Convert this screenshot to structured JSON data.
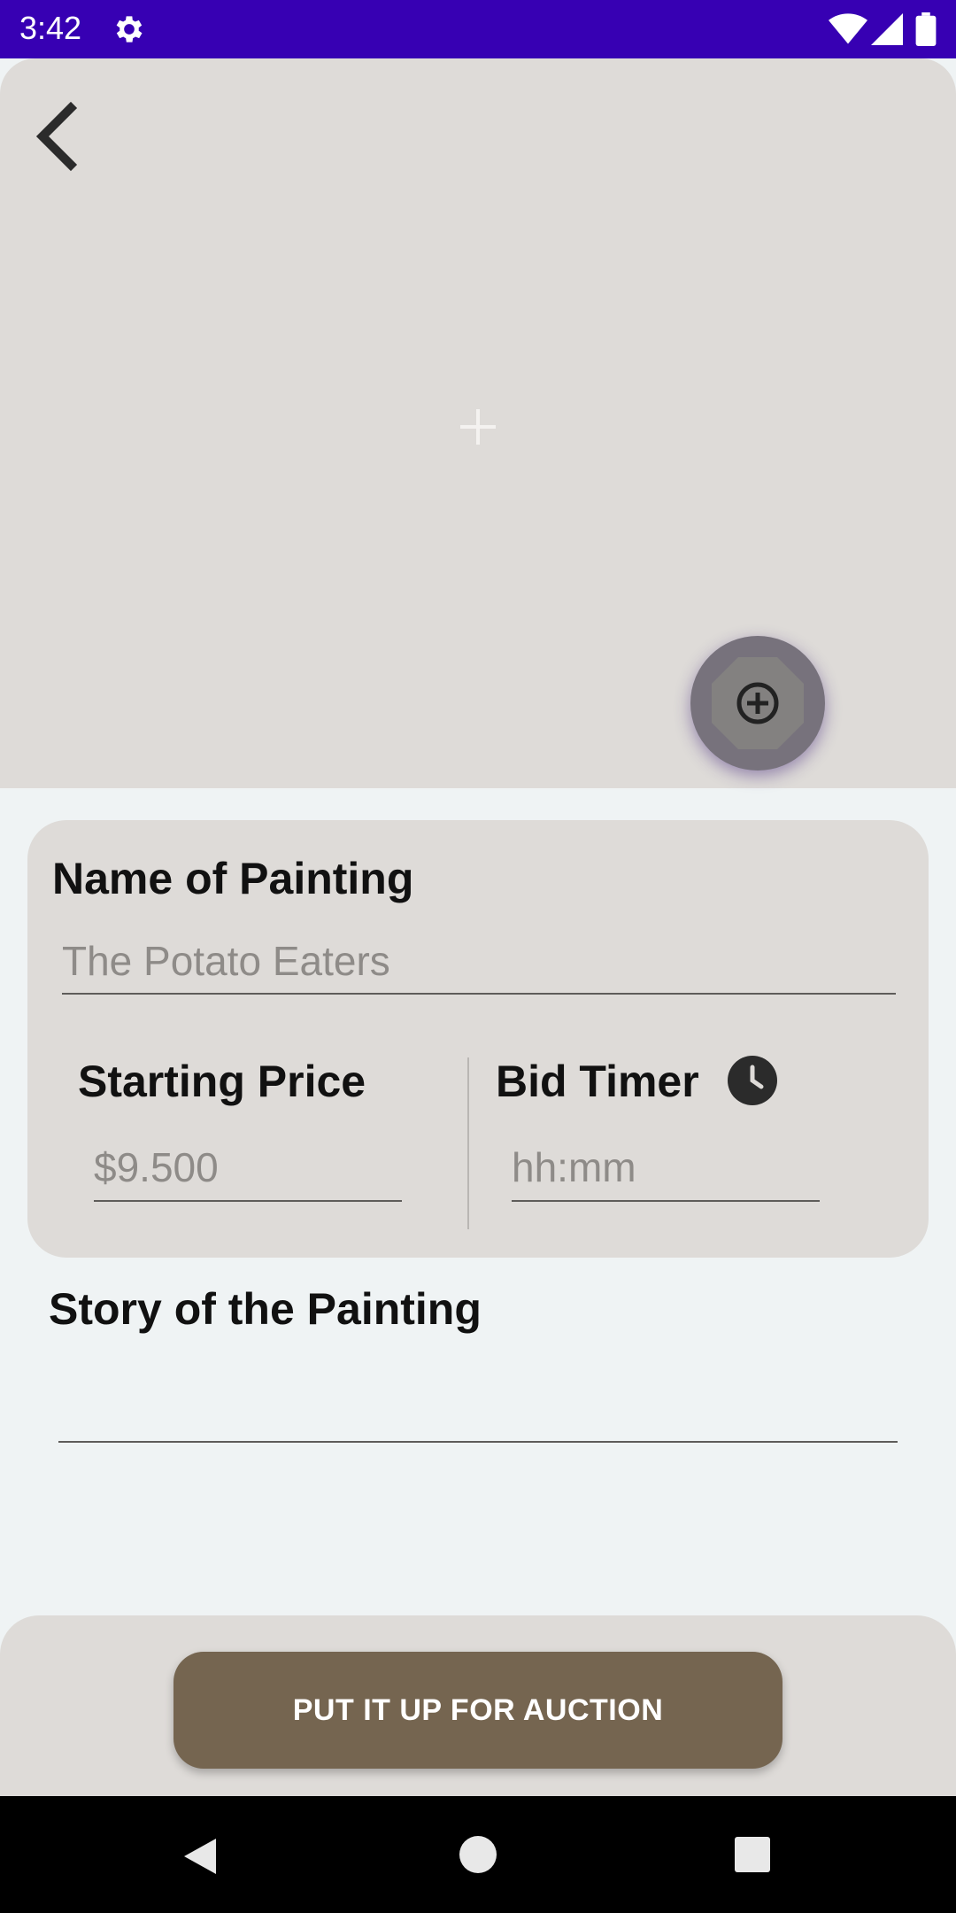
{
  "status_bar": {
    "time": "3:42",
    "icons": [
      "settings-gear-icon",
      "wifi-icon",
      "cell-signal-icon",
      "battery-icon"
    ],
    "background": "#3700b3"
  },
  "header": {
    "back_icon": "chevron-left-icon",
    "image_placeholder_icon": "plus-icon",
    "add_photo_icon": "add-circle-icon"
  },
  "form": {
    "name_label": "Name of Painting",
    "name_placeholder": "The Potato Eaters",
    "price_label": "Starting Price",
    "price_placeholder": "$9.500",
    "timer_label": "Bid Timer",
    "timer_icon": "clock-icon",
    "timer_placeholder": "hh:mm",
    "story_label": "Story of the Painting",
    "story_value": ""
  },
  "action": {
    "submit_label": "PUT IT UP FOR AUCTION",
    "button_color": "#756550"
  },
  "nav_bar": {
    "icons": [
      "back-triangle-icon",
      "home-circle-icon",
      "recents-square-icon"
    ]
  }
}
